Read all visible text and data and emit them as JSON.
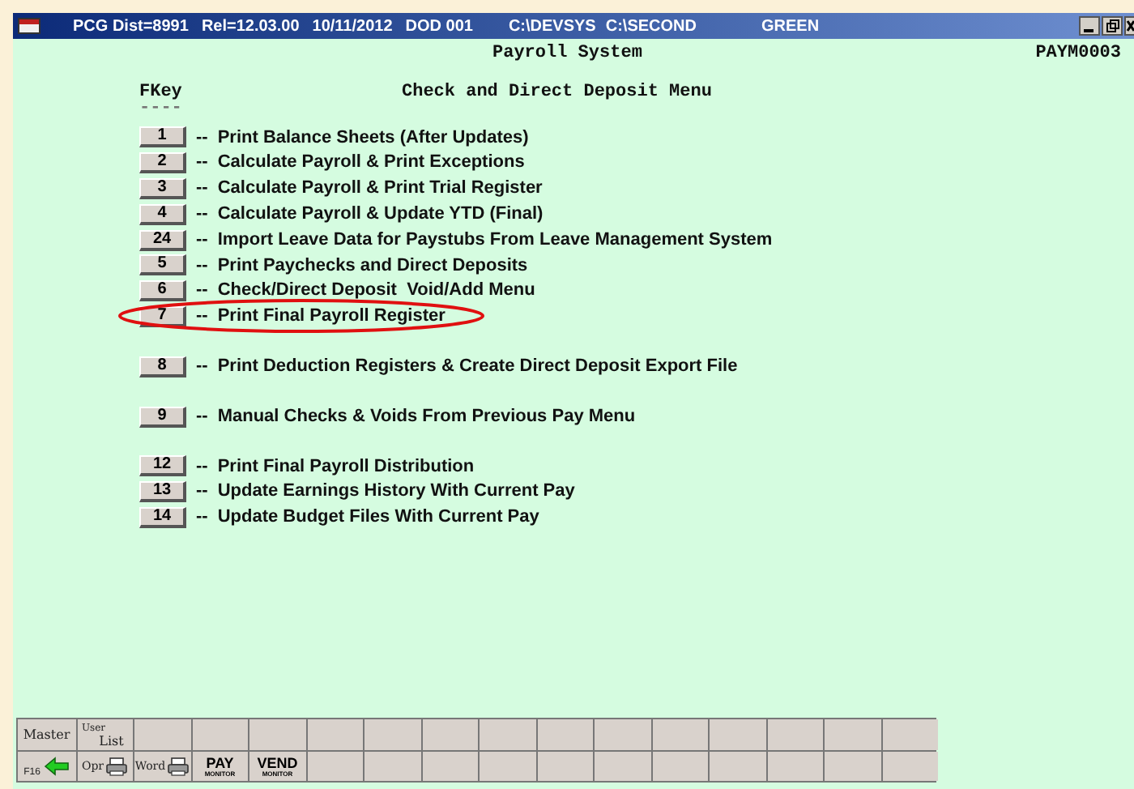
{
  "window": {
    "title_segments": [
      "PCG Dist=8991",
      "Rel=12.03.00",
      "10/11/2012",
      "DOD 001",
      "C:\\DEVSYS",
      "C:\\SECOND",
      "GREEN"
    ]
  },
  "header": {
    "system": "Payroll System",
    "screen_id": "PAYM0003",
    "fkey_label": "FKey",
    "fkey_rule": "----",
    "menu_title": "Check and Direct Deposit Menu"
  },
  "menu_groups": [
    [
      {
        "key": "1",
        "dashes": "--",
        "label": "Print Balance Sheets (After Updates)",
        "circled": false
      },
      {
        "key": "2",
        "dashes": "--",
        "label": "Calculate Payroll & Print Exceptions",
        "circled": false
      },
      {
        "key": "3",
        "dashes": "--",
        "label": "Calculate Payroll & Print Trial Register",
        "circled": false
      },
      {
        "key": "4",
        "dashes": "--",
        "label": "Calculate Payroll & Update YTD (Final)",
        "circled": false
      },
      {
        "key": "24",
        "dashes": "--",
        "label": "Import Leave Data for Paystubs From Leave Management System",
        "circled": false
      },
      {
        "key": "5",
        "dashes": "--",
        "label": "Print Paychecks and Direct Deposits",
        "circled": false
      },
      {
        "key": "6",
        "dashes": "--",
        "label": "Check/Direct Deposit  Void/Add Menu",
        "circled": false
      },
      {
        "key": "7",
        "dashes": "--",
        "label": "Print Final Payroll Register",
        "circled": true
      }
    ],
    [
      {
        "key": "8",
        "dashes": "--",
        "label": "Print Deduction Registers & Create Direct Deposit Export File",
        "circled": false
      }
    ],
    [
      {
        "key": "9",
        "dashes": "--",
        "label": "Manual Checks & Voids From Previous Pay Menu",
        "circled": false
      }
    ],
    [
      {
        "key": "12",
        "dashes": "--",
        "label": "Print Final Payroll Distribution",
        "circled": false
      },
      {
        "key": "13",
        "dashes": "--",
        "label": "Update Earnings History With Current Pay",
        "circled": false
      },
      {
        "key": "14",
        "dashes": "--",
        "label": "Update Budget Files With Current Pay",
        "circled": false
      }
    ]
  ],
  "toolbar": [
    [
      {
        "kind": "text",
        "label": "Master"
      },
      {
        "kind": "stacked",
        "label": "User",
        "sublabel": "List"
      },
      {
        "kind": "empty"
      },
      {
        "kind": "empty"
      },
      {
        "kind": "empty"
      },
      {
        "kind": "empty"
      },
      {
        "kind": "empty"
      },
      {
        "kind": "empty"
      },
      {
        "kind": "empty"
      },
      {
        "kind": "empty"
      },
      {
        "kind": "empty"
      },
      {
        "kind": "empty"
      },
      {
        "kind": "empty"
      },
      {
        "kind": "empty"
      },
      {
        "kind": "empty"
      },
      {
        "kind": "empty"
      }
    ],
    [
      {
        "kind": "back",
        "label": "F16"
      },
      {
        "kind": "printer",
        "label": "Opr"
      },
      {
        "kind": "printer",
        "label": "Word"
      },
      {
        "kind": "monitor",
        "label": "PAY",
        "sublabel": "MONITOR"
      },
      {
        "kind": "monitor",
        "label": "VEND",
        "sublabel": "MONITOR"
      },
      {
        "kind": "empty"
      },
      {
        "kind": "empty"
      },
      {
        "kind": "empty"
      },
      {
        "kind": "empty"
      },
      {
        "kind": "empty"
      },
      {
        "kind": "empty"
      },
      {
        "kind": "empty"
      },
      {
        "kind": "empty"
      },
      {
        "kind": "empty"
      },
      {
        "kind": "empty"
      },
      {
        "kind": "empty"
      }
    ]
  ]
}
